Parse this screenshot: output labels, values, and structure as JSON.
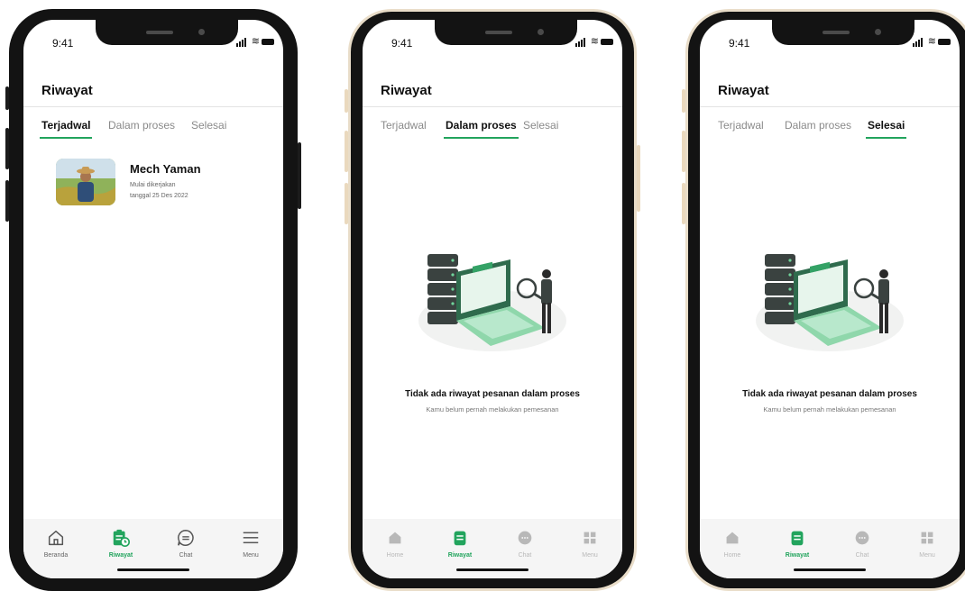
{
  "status_time": "9:41",
  "screen_title": "Riwayat",
  "tabs": [
    "Terjadwal",
    "Dalam proses",
    "Selesai"
  ],
  "schedule": {
    "name": "Mech Yaman",
    "line1": "Mulai dikerjakan",
    "line2": "tanggal 25 Des 2022"
  },
  "empty_state": {
    "title": "Tidak ada riwayat pesanan dalam proses",
    "subtitle": "Kamu belum pernah melakukan pemesanan"
  },
  "nav_v1": [
    "Beranda",
    "Riwayat",
    "Chat",
    "Menu"
  ],
  "nav_v2": [
    "Home",
    "Riwayat",
    "Chat",
    "Menu"
  ],
  "colors": {
    "accent": "#22a45d",
    "frame": "#131313",
    "frame_trim": "#e9ddc9"
  },
  "icons": [
    "home-icon",
    "history-icon",
    "chat-icon",
    "menu-icon",
    "grid-icon"
  ]
}
